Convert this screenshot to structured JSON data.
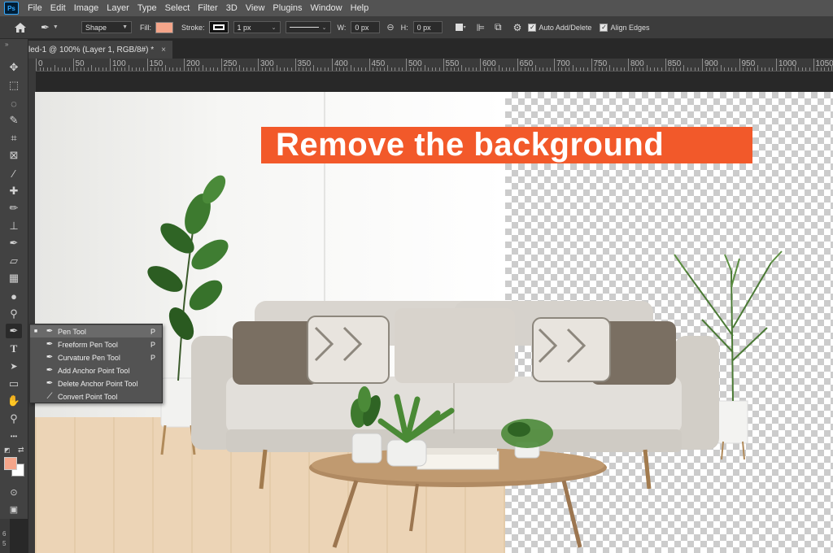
{
  "app": {
    "logo_text": "Ps"
  },
  "menu": [
    "File",
    "Edit",
    "Image",
    "Layer",
    "Type",
    "Select",
    "Filter",
    "3D",
    "View",
    "Plugins",
    "Window",
    "Help"
  ],
  "options": {
    "mode_value": "Shape",
    "fill_label": "Fill:",
    "fill_color": "#f4a58a",
    "stroke_label": "Stroke:",
    "stroke_width": "1 px",
    "w_label": "W:",
    "w_value": "0 px",
    "h_label": "H:",
    "h_value": "0 px",
    "auto_add_delete_label": "Auto Add/Delete",
    "auto_add_delete_checked": true,
    "align_edges_label": "Align Edges",
    "align_edges_checked": true
  },
  "tab": {
    "title": "led-1 @ 100% (Layer 1, RGB/8#) *",
    "close": "×"
  },
  "ruler": {
    "labels": [
      "0",
      "50",
      "100",
      "150",
      "200",
      "250",
      "300",
      "350",
      "400",
      "450",
      "500",
      "550",
      "600",
      "650",
      "700",
      "750",
      "800",
      "850",
      "900",
      "950",
      "1000",
      "1050"
    ],
    "side_labels": [
      "6",
      "5"
    ]
  },
  "canvas": {
    "headline": "Remove the background",
    "headline_color": "#f2592a"
  },
  "tools": [
    {
      "name": "move-tool",
      "glyph": "✥"
    },
    {
      "name": "marquee-tool",
      "glyph": "⬚"
    },
    {
      "name": "lasso-tool",
      "glyph": "◌"
    },
    {
      "name": "quick-selection-tool",
      "glyph": "✎"
    },
    {
      "name": "crop-tool",
      "glyph": "⌗"
    },
    {
      "name": "frame-tool",
      "glyph": "⊠"
    },
    {
      "name": "eyedropper-tool",
      "glyph": "⁄"
    },
    {
      "name": "healing-brush-tool",
      "glyph": "✚"
    },
    {
      "name": "brush-tool",
      "glyph": "✏"
    },
    {
      "name": "clone-stamp-tool",
      "glyph": "⊥"
    },
    {
      "name": "history-brush-tool",
      "glyph": "✒"
    },
    {
      "name": "eraser-tool",
      "glyph": "▱"
    },
    {
      "name": "gradient-tool",
      "glyph": "▦"
    },
    {
      "name": "blur-tool",
      "glyph": "●"
    },
    {
      "name": "dodge-tool",
      "glyph": "⚲"
    },
    {
      "name": "pen-tool",
      "glyph": "✒"
    },
    {
      "name": "type-tool",
      "glyph": "T"
    },
    {
      "name": "path-selection-tool",
      "glyph": "➤"
    },
    {
      "name": "rectangle-tool",
      "glyph": "▭"
    },
    {
      "name": "hand-tool",
      "glyph": "✋"
    },
    {
      "name": "zoom-tool",
      "glyph": "⚲"
    },
    {
      "name": "more-tools",
      "glyph": "•••"
    }
  ],
  "colors": {
    "foreground": "#f4a58a",
    "background": "#ffffff"
  },
  "pen_flyout": {
    "items": [
      {
        "label": "Pen Tool",
        "key": "P",
        "selected": true
      },
      {
        "label": "Freeform Pen Tool",
        "key": "P",
        "selected": false
      },
      {
        "label": "Curvature Pen Tool",
        "key": "P",
        "selected": false
      },
      {
        "label": "Add Anchor Point Tool",
        "key": "",
        "selected": false
      },
      {
        "label": "Delete Anchor Point Tool",
        "key": "",
        "selected": false
      },
      {
        "label": "Convert Point Tool",
        "key": "",
        "selected": false
      }
    ]
  }
}
